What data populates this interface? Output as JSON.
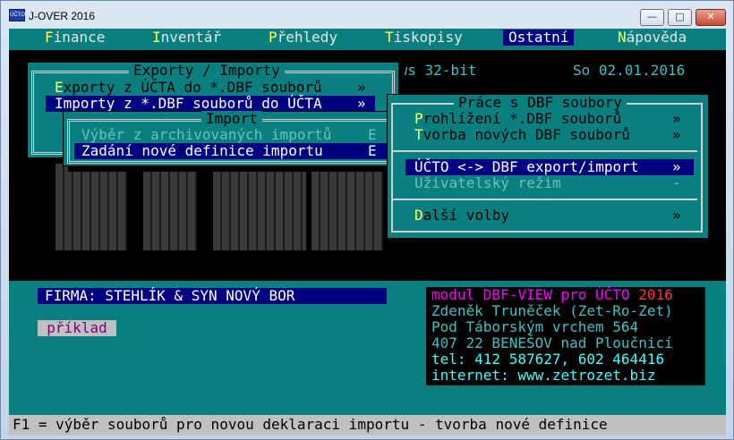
{
  "window": {
    "icon_text": "ÚČTO",
    "title": "J-OVER 2016",
    "buttons": {
      "minimize": "—",
      "maximize": "□",
      "close": "✕"
    }
  },
  "menubar": [
    {
      "hotkey": "F",
      "rest": "inance"
    },
    {
      "hotkey": "I",
      "rest": "nventář"
    },
    {
      "hotkey": "P",
      "rest": "řehledy"
    },
    {
      "hotkey": "T",
      "rest": "iskopisy"
    },
    {
      "hotkey": "",
      "rest": "Ostatní"
    },
    {
      "hotkey": "N",
      "rest": "ápověda"
    }
  ],
  "header": {
    "os_fragment": "ows 32-bit",
    "date": "So 02.01.2016"
  },
  "exporty_menu": {
    "title": "Exporty / Importy",
    "items": [
      {
        "hotkey": "E",
        "rest": "xporty z ÚČTA do *.DBF souborů",
        "arrow": "»"
      },
      {
        "hotkey": "",
        "rest": "Importy z *.DBF souborů do ÚČTA",
        "arrow": "»"
      }
    ]
  },
  "import_menu": {
    "title": "Import",
    "items": [
      {
        "label": "Výběr z archivovaných importů",
        "key": "E"
      },
      {
        "label": "Zadání nové definice importu",
        "key": "E"
      }
    ]
  },
  "dbf_menu": {
    "title": "Práce s DBF soubory",
    "items": [
      {
        "hotkey": "P",
        "rest": "rohlížení *.DBF souborů",
        "arrow": "»"
      },
      {
        "hotkey": "T",
        "rest": "vorba nových DBF souborů",
        "arrow": "»"
      },
      {
        "hotkey": "",
        "rest": "ÚČTO <-> DBF export/import",
        "arrow": "»"
      },
      {
        "hotkey": "U",
        "rest": "živatelský režim",
        "arrow": "-"
      },
      {
        "hotkey": "D",
        "rest": "alší volby",
        "arrow": "»"
      }
    ]
  },
  "firma": "FIRMA: STEHLÍK & SYN NOVÝ BOR",
  "priklad": "příklad",
  "info": {
    "module": "modul DBF-VIEW pro ÚČTO",
    "year": "2016",
    "author": "Zdeněk Truněček (Zet-Ro-Zet)",
    "street": "Pod Táborským vrchem 564",
    "city": "407 22 BENEŠOV nad Ploučnicí",
    "tel": "tel: 412 587627, 602 464416",
    "web": "internet: www.zetrozet.biz",
    "colors": {
      "module": "#ff00ff",
      "year": "#ff3030",
      "address": "#40c0c0",
      "contact": "#40ffff"
    }
  },
  "status": "F1 = výběr souborů pro novou deklaraci importu - tvorba nové definice"
}
